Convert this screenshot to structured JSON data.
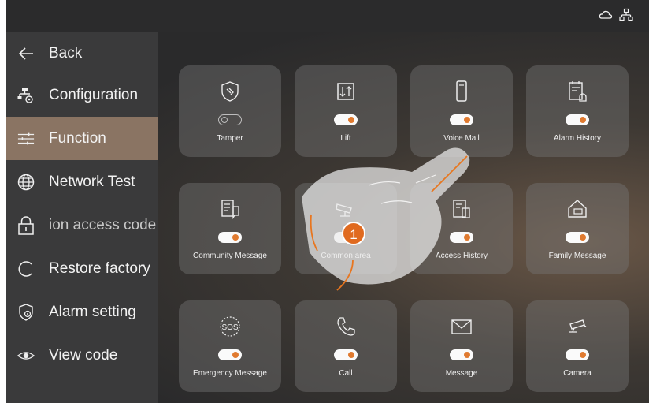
{
  "sidebar": {
    "items": [
      {
        "label": "Back",
        "icon": "back-arrow-icon"
      },
      {
        "label": "Configuration",
        "icon": "configuration-icon"
      },
      {
        "label": "Function",
        "icon": "sliders-icon",
        "active": true
      },
      {
        "label": "Network Test",
        "icon": "globe-icon"
      },
      {
        "label": "ion access code",
        "icon": "lock-icon"
      },
      {
        "label": "Restore factory",
        "icon": "restore-icon"
      },
      {
        "label": "Alarm setting",
        "icon": "shield-gear-icon"
      },
      {
        "label": "View code",
        "icon": "eye-icon"
      }
    ]
  },
  "topbar": {
    "icons": [
      "cloud-icon",
      "network-icon"
    ]
  },
  "tiles": [
    {
      "label": "Tamper",
      "icon": "tamper-shield-icon",
      "on": false
    },
    {
      "label": "Lift",
      "icon": "lift-icon",
      "on": true
    },
    {
      "label": "Voice Mail",
      "icon": "voice-mail-phone-icon",
      "on": true
    },
    {
      "label": "Alarm History",
      "icon": "alarm-history-icon",
      "on": true
    },
    {
      "label": "Community Message",
      "icon": "community-message-icon",
      "on": true
    },
    {
      "label": "Common area",
      "icon": "cctv-icon",
      "on": true
    },
    {
      "label": "Access History",
      "icon": "access-history-icon",
      "on": true
    },
    {
      "label": "Family Message",
      "icon": "house-message-icon",
      "on": true
    },
    {
      "label": "Emergency Message",
      "icon": "sos-icon",
      "on": true
    },
    {
      "label": "Call",
      "icon": "phone-icon",
      "on": true
    },
    {
      "label": "Message",
      "icon": "envelope-icon",
      "on": true
    },
    {
      "label": "Camera",
      "icon": "camera-icon",
      "on": true
    }
  ],
  "step_badge": "1",
  "colors": {
    "accent": "#e07a2f",
    "active_bg": "#8a7463",
    "sidebar_bg": "#3a3a3b"
  }
}
